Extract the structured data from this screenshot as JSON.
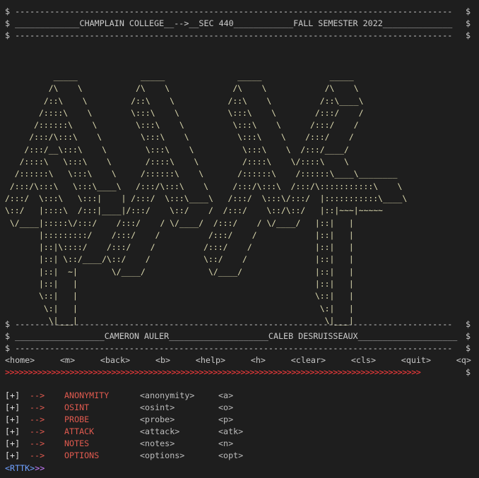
{
  "header": {
    "line1": "$ ----------------------------------------------------------------------------------------",
    "line1_end": "$",
    "line2": "$ _____________CHAMPLAIN COLLEGE__-->__SEC 440____________FALL SEMESTER 2022______________",
    "line2_end": "$",
    "line3": "$ ----------------------------------------------------------------------------------------",
    "line3_end": "$"
  },
  "ascii_art": "          _____             _____               _____              _____\n         /\\    \\           /\\    \\             /\\    \\            /\\    \\\n        /::\\    \\         /::\\    \\           /::\\    \\          /::\\____\\\n       /::::\\    \\        \\:::\\    \\          \\:::\\    \\        /:::/    /\n      /::::::\\    \\        \\:::\\    \\          \\:::\\    \\      /:::/    /\n     /:::/\\:::\\    \\        \\:::\\    \\          \\:::\\    \\    /:::/    /\n    /:::/__\\:::\\    \\        \\:::\\    \\          \\:::\\    \\  /:::/____/\n   /::::\\   \\:::\\    \\       /::::\\    \\         /::::\\    \\/::::\\    \\\n  /::::::\\   \\:::\\    \\     /::::::\\    \\       /::::::\\    /::::::\\____\\________\n /:::/\\:::\\   \\:::\\____\\   /:::/\\:::\\    \\     /:::/\\:::\\  /:::/\\:::::::::::\\    \\\n/:::/  \\:::\\   \\:::|    | /:::/  \\:::\\____\\   /:::/  \\:::\\/:::/  |:::::::::::\\____\\\n\\::/   |::::\\  /:::|____|/:::/    \\::/    /  /:::/    \\::/\\::/   |::|~~~|~~~~~\n \\/____|:::::\\/:::/    /:::/    / \\/____/  /:::/    / \\/____/   |::|   |\n       |:::::::::/    /:::/    /          /:::/    /            |::|   |\n       |::|\\::::/    /:::/    /          /:::/    /             |::|   |\n       |::| \\::/____/\\::/    /           \\::/    /              |::|   |\n       |::|  ~|       \\/____/             \\/____/               |::|   |\n       |::|   |                                                 |::|   |\n       \\::|   |                                                 \\::|   |\n        \\:|   |                                                  \\:|   |\n         \\|___|                                                   \\|___|",
  "footer": {
    "line1": "$ ----------------------------------------------------------------------------------------",
    "line1_end": "$",
    "line2": "$ __________________CAMERON AULER____________________CALEB DESRUISSEAUX____________________",
    "line2_end": "$",
    "line3": "$ ----------------------------------------------------------------------------------------",
    "line3_end": "$"
  },
  "commands": [
    "<home>",
    "<m>",
    "<back>",
    "<b>",
    "<help>",
    "<h>",
    "<clear>",
    "<cls>",
    "<quit>",
    "<q>"
  ],
  "arrow_line": ">>>>>>>>>>>>>>>>>>>>>>>>>>>>>>>>>>>>>>>>>>>>>>>>>>>>>>>>>>>>>>>>>>>>>>>>>>>>>>>>>>>>>>>>>>",
  "arrow_end": "$",
  "menu": [
    {
      "tag": "[+]",
      "arrow": "-->",
      "label": "ANONYMITY",
      "long": "<anonymity>",
      "short": "<a>"
    },
    {
      "tag": "[+]",
      "arrow": "-->",
      "label": "OSINT",
      "long": "<osint>",
      "short": "<o>"
    },
    {
      "tag": "[+]",
      "arrow": "-->",
      "label": "PROBE",
      "long": "<probe>",
      "short": "<p>"
    },
    {
      "tag": "[+]",
      "arrow": "-->",
      "label": "ATTACK",
      "long": "<attack>",
      "short": "<atk>"
    },
    {
      "tag": "[+]",
      "arrow": "-->",
      "label": "NOTES",
      "long": "<notes>",
      "short": "<n>"
    },
    {
      "tag": "[+]",
      "arrow": "-->",
      "label": "OPTIONS",
      "long": "<options>",
      "short": "<opt>"
    }
  ],
  "prompt": {
    "name": "<RTTK>",
    "suffix": ">>"
  },
  "colors": {
    "background": "#1e1e1e",
    "art": "#e2dfb3",
    "menu_accent": "#e05a4f",
    "prompt_blue": "#6fa0ff",
    "prompt_purple": "#c77dff"
  }
}
